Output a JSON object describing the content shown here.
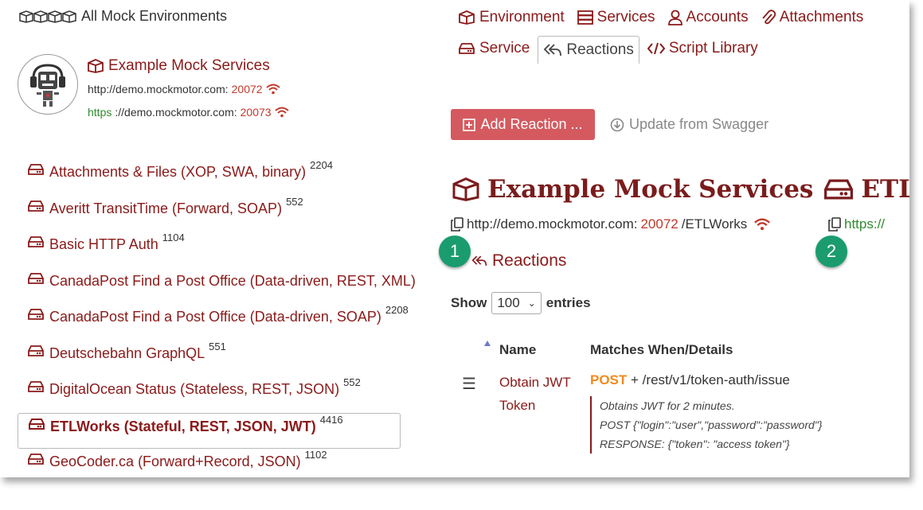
{
  "env": {
    "title": "All Mock Environments"
  },
  "service": {
    "name": "Example Mock Services",
    "url_http_prefix": "http://demo.mockmotor.com:",
    "url_http_port": "20072",
    "url_https_scheme": "https",
    "url_https_rest": "://demo.mockmotor.com:",
    "url_https_port": "20073"
  },
  "service_list": [
    {
      "label": "Attachments & Files (XOP, SWA, binary)",
      "count": "2204"
    },
    {
      "label": "Averitt TransitTime (Forward, SOAP)",
      "count": "552"
    },
    {
      "label": "Basic HTTP Auth",
      "count": "1104"
    },
    {
      "label": "CanadaPost Find a Post Office (Data-driven, REST, XML)",
      "count": ""
    },
    {
      "label": "CanadaPost Find a Post Office (Data-driven, SOAP)",
      "count": "2208"
    },
    {
      "label": "Deutschebahn GraphQL",
      "count": "551"
    },
    {
      "label": "DigitalOcean Status (Stateless, REST, JSON)",
      "count": "552"
    },
    {
      "label": "ETLWorks (Stateful, REST, JSON, JWT)",
      "count": "4416"
    },
    {
      "label": "GeoCoder.ca (Forward+Record, JSON)",
      "count": "1102"
    }
  ],
  "nav": {
    "environment": "Environment",
    "services": "Services",
    "accounts": "Accounts",
    "attachments": "Attachments",
    "service": "Service",
    "reactions": "Reactions",
    "script_library": "Script Library"
  },
  "actions": {
    "add_reaction": "Add Reaction ...",
    "update_swagger": "Update from Swagger"
  },
  "header": {
    "title": "Example Mock Services",
    "title_suffix": "ETLW",
    "endpoint_prefix": "http://demo.mockmotor.com:",
    "endpoint_port": "20072",
    "endpoint_path": "/ETLWorks",
    "endpoint_https": "https://"
  },
  "badges": {
    "one": "1",
    "two": "2"
  },
  "reactions": {
    "heading": "Reactions",
    "show_label": "Show",
    "entries_value": "100",
    "entries_label": "entries",
    "col_name": "Name",
    "col_matches": "Matches When/Details",
    "rows": [
      {
        "name": "Obtain JWT Token",
        "method": "POST",
        "path": "+ /rest/v1/token-auth/issue",
        "details": [
          "Obtains JWT for 2 minutes.",
          "POST {\"login\":\"user\",\"password\":\"password\"}",
          "RESPONSE: {\"token\": \"access token\"}"
        ]
      }
    ]
  },
  "colors": {
    "brand": "#8b1a1a",
    "button": "#d45a5f",
    "badge": "#1a9c6e",
    "method": "#f28b1a"
  }
}
